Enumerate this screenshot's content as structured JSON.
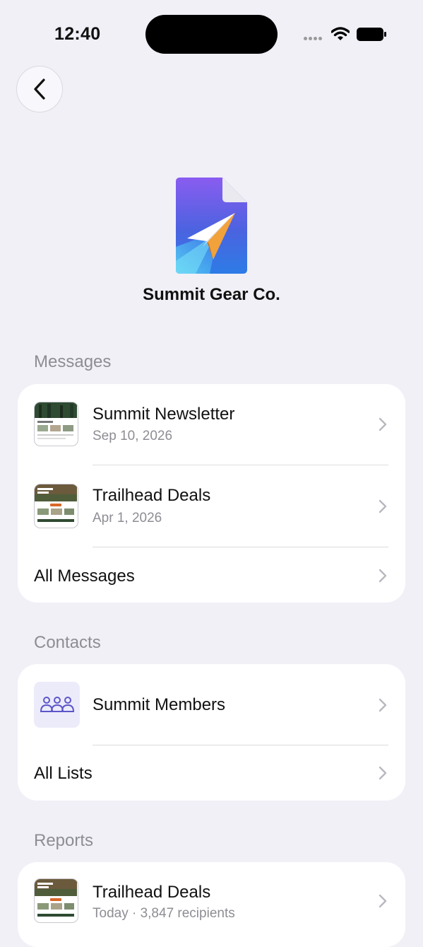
{
  "status_bar": {
    "time": "12:40"
  },
  "account": {
    "name": "Summit Gear Co."
  },
  "messages": {
    "section_title": "Messages",
    "items": [
      {
        "title": "Summit Newsletter",
        "date": "Sep 10, 2026"
      },
      {
        "title": "Trailhead Deals",
        "date": "Apr 1, 2026"
      }
    ],
    "all_label": "All Messages"
  },
  "contacts": {
    "section_title": "Contacts",
    "items": [
      {
        "title": "Summit Members"
      }
    ],
    "all_label": "All Lists"
  },
  "reports": {
    "section_title": "Reports",
    "items": [
      {
        "title": "Trailhead Deals",
        "subtitle": "Today · 3,847 recipients"
      }
    ]
  },
  "colors": {
    "accent": "#5b55c9",
    "background": "#f1f0f7"
  }
}
